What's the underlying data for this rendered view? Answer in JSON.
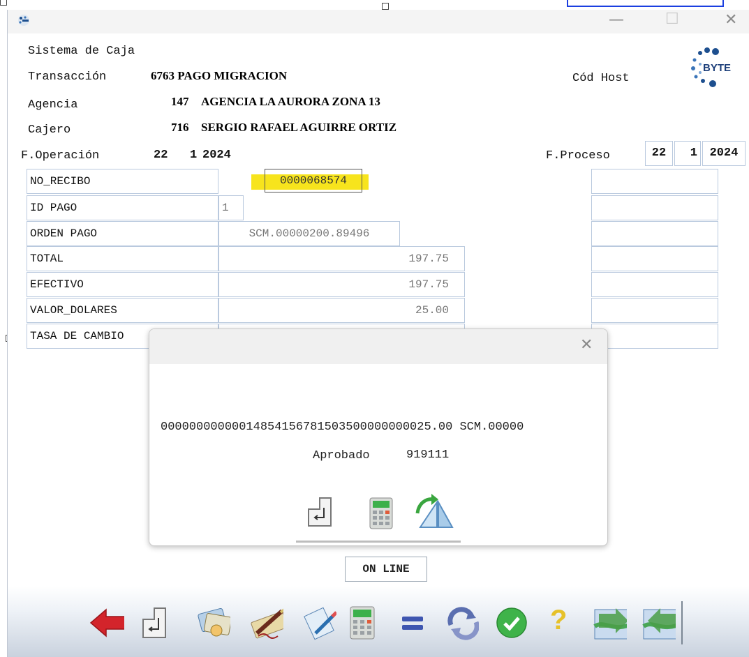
{
  "window": {
    "minimize_glyph": "—",
    "maximize_glyph": "☐",
    "close_glyph": "✕",
    "app_icon": "byte-app-icon"
  },
  "header": {
    "system_title": "Sistema de Caja",
    "transaction_label": "Transacción",
    "transaction_value": "6763 PAGO MIGRACION",
    "host_label": "Cód Host",
    "agency_label": "Agencia",
    "agency_code": "147",
    "agency_name": "AGENCIA LA AURORA ZONA 13",
    "cashier_label": "Cajero",
    "cashier_code": "716",
    "cashier_name": "SERGIO RAFAEL AGUIRRE ORTIZ",
    "op_date_label": "F.Operación",
    "op_day": "22",
    "op_month": "1",
    "op_year": "2024",
    "proc_date_label": "F.Proceso",
    "proc_day": "22",
    "proc_month": "1",
    "proc_year": "2024",
    "logo_text": "BYTE"
  },
  "form": {
    "fields": [
      {
        "label": "NO_RECIBO",
        "value": "0000068574"
      },
      {
        "label": "ID PAGO",
        "value": "1"
      },
      {
        "label": "ORDEN PAGO",
        "value": "SCM.00000200.89496"
      },
      {
        "label": "TOTAL",
        "value": "197.75"
      },
      {
        "label": "EFECTIVO",
        "value": "197.75"
      },
      {
        "label": "VALOR_DOLARES",
        "value": "25.00"
      },
      {
        "label": "TASA DE CAMBIO",
        "value": ""
      }
    ]
  },
  "dialog": {
    "close_glyph": "✕",
    "message_line": "00000000000014854156781503500000000025.00 SCM.00000",
    "approved_label": "Aprobado",
    "approved_code": "919111",
    "icons": [
      "enter-icon",
      "calculator-icon",
      "refresh-prism-icon"
    ]
  },
  "status": {
    "online_text": "ON LINE"
  },
  "toolbar": {
    "icons": [
      "back-arrow-icon",
      "enter-icon",
      "bills-icon",
      "signature-icon",
      "document-edit-icon",
      "calculator-icon",
      "equals-icon",
      "sync-icon",
      "check-icon",
      "help-icon",
      "map-prev-icon",
      "map-next-icon"
    ],
    "help_glyph": "?",
    "equals_glyph": "="
  },
  "colors": {
    "highlight": "#f7e41d",
    "field_border": "#b9c9de",
    "back_arrow": "#d3242b",
    "check_green": "#3fb34a",
    "help_yellow": "#e6c12a"
  }
}
